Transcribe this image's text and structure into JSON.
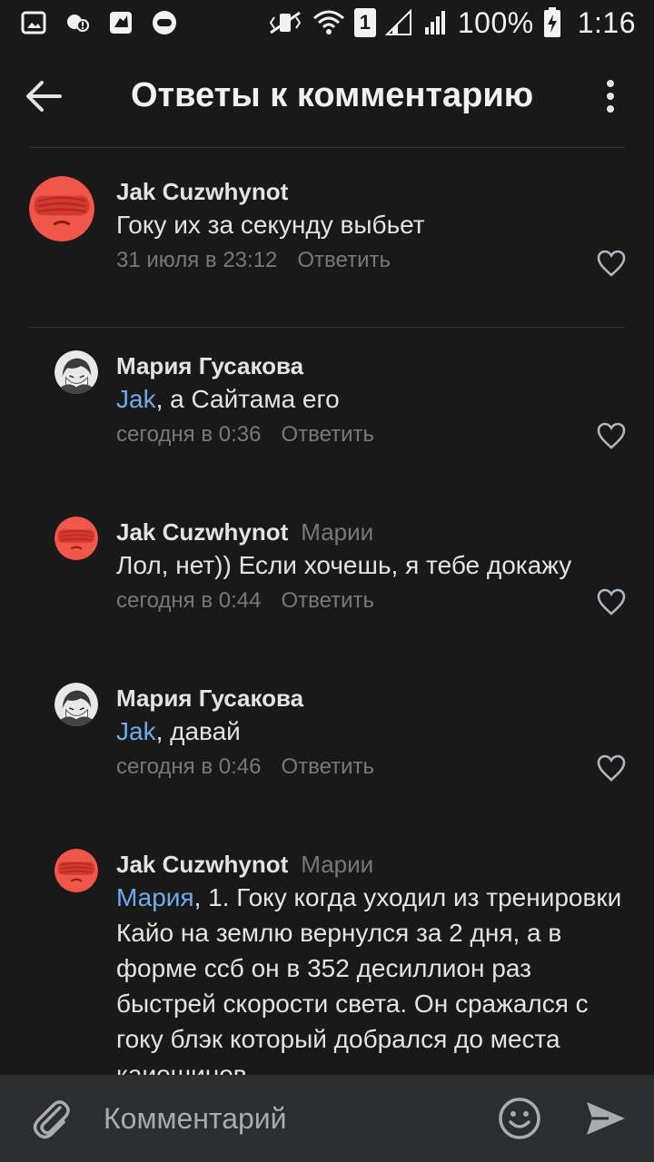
{
  "statusbar": {
    "battery": "100%",
    "time": "1:16",
    "sim_badge": "1"
  },
  "header": {
    "title": "Ответы к комментарию"
  },
  "comments": [
    {
      "author": "Jak Cuzwhynot",
      "reply_to": "",
      "mention": "",
      "text": "Гоку их за секунду выбьет",
      "time": "31 июля в 23:12",
      "reply_label": "Ответить",
      "avatar": "red-masked-face"
    },
    {
      "author": "Мария Гусакова",
      "reply_to": "",
      "mention": "Jak",
      "text": ", а Сайтама его",
      "time": "сегодня в 0:36",
      "reply_label": "Ответить",
      "avatar": "manga-character"
    },
    {
      "author": "Jak Cuzwhynot",
      "reply_to": "Марии",
      "mention": "",
      "text": "Лол, нет)) Если хочешь, я тебе докажу",
      "time": "сегодня в 0:44",
      "reply_label": "Ответить",
      "avatar": "red-masked-face"
    },
    {
      "author": "Мария Гусакова",
      "reply_to": "",
      "mention": "Jak",
      "text": ", давай",
      "time": "сегодня в 0:46",
      "reply_label": "Ответить",
      "avatar": "manga-character"
    },
    {
      "author": "Jak Cuzwhynot",
      "reply_to": "Марии",
      "mention": "Мария",
      "text": ", 1. Гоку когда уходил из тренировки Кайо на землю вернулся за 2 дня, а в форме ссб он в 352 десиллион раз быстрей скорости света. Он сражался с гоку блэк который добрался до места каиошинов",
      "time": "",
      "reply_label": "",
      "avatar": "red-masked-face"
    }
  ],
  "composer": {
    "placeholder": "Комментарий"
  },
  "colors": {
    "background": "#19191a",
    "mention": "#71aaeb",
    "secondary_text": "#76787a",
    "composer_bg": "#2c2d2e"
  }
}
